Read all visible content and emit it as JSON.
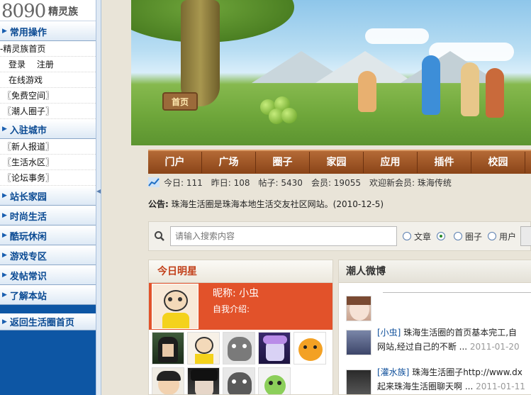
{
  "logo": {
    "number": "8090",
    "text": "精灵族"
  },
  "sidebar": {
    "sections": [
      {
        "title": "常用操作",
        "items": [
          {
            "label": "-精灵族首页",
            "style": "top"
          },
          {
            "label": "登录 注册",
            "style": "ind2"
          },
          {
            "label": "在线游戏",
            "style": "ind1"
          },
          {
            "label": "〖免费空间〗",
            "style": "ind3"
          },
          {
            "label": "〖潮人圈子〗",
            "style": "ind3"
          }
        ]
      },
      {
        "title": "入驻城市",
        "items": [
          {
            "label": "〖新人报道〗",
            "style": "ind3"
          },
          {
            "label": "〖生活水区〗",
            "style": "ind3"
          },
          {
            "label": "〖论坛事务〗",
            "style": "ind3"
          }
        ]
      },
      {
        "title": "站长家园",
        "items": []
      },
      {
        "title": "时尚生活",
        "items": []
      },
      {
        "title": "酷玩休闲",
        "items": []
      },
      {
        "title": "游戏专区",
        "items": []
      },
      {
        "title": "发帖常识",
        "items": []
      },
      {
        "title": "了解本站",
        "items": []
      }
    ],
    "back_home": "返回生活圈首页"
  },
  "banner": {
    "sign_label": "首页"
  },
  "nav": [
    "门户",
    "广场",
    "圈子",
    "家园",
    "应用",
    "插件",
    "校园"
  ],
  "stats": {
    "today": "今日: 111",
    "yesterday": "昨日: 108",
    "posts": "帖子: 5430",
    "members": "会员: 19055",
    "welcome": "欢迎新会员: 珠海传统"
  },
  "notice": {
    "label": "公告:",
    "text": "珠海生活圈是珠海本地生活交友社区网站。(2010-12-5)"
  },
  "search": {
    "placeholder": "请输入搜索内容",
    "options": [
      {
        "label": "文章",
        "checked": false
      },
      {
        "label": "",
        "checked": true
      },
      {
        "label": "圈子",
        "checked": false
      },
      {
        "label": "用户",
        "checked": false
      }
    ]
  },
  "star": {
    "title": "今日明星",
    "nickname": "昵称: 小虫",
    "intro": "自我介绍:"
  },
  "weibo": {
    "title": "潮人微博",
    "items": [
      {
        "user": "[小虫]",
        "line1": "珠海生活圈的首页基本完工,自",
        "line2": "网站,经过自己的不断 ...",
        "time": "2011-01-20"
      },
      {
        "user": "[灌水族]",
        "line1": "珠海生活圈子http://www.dx",
        "line2": "起来珠海生活圈聊天啊 ...",
        "time": "2011-01-11"
      }
    ]
  },
  "colors": {
    "sidebar_blue": "#0d56a4",
    "nav_brown": "#9a5222",
    "star_red": "#e2522a",
    "title_red": "#c2401a"
  }
}
